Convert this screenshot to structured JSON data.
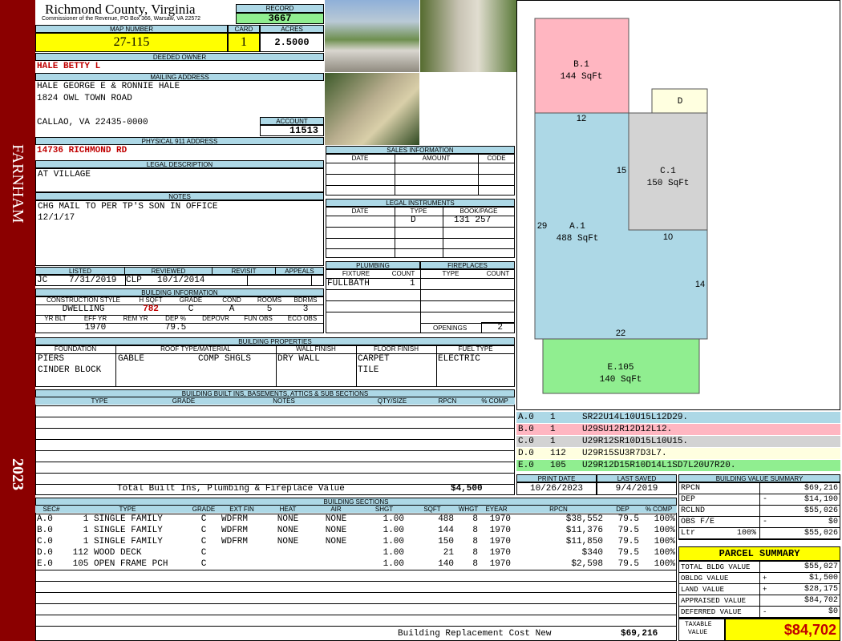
{
  "side_band": {
    "town": "FARNHAM",
    "year": "2023"
  },
  "header": {
    "county": "Richmond County, Virginia",
    "commissioner": "Commissioner of the Revenue, PO Box 366, Warsaw, VA 22572",
    "record_label": "RECORD",
    "record_value": "3667",
    "map_label": "MAP NUMBER",
    "map_value": "27-115",
    "card_label": "CARD",
    "card_value": "1",
    "acres_label": "ACRES",
    "acres_value": "2.5000"
  },
  "owner": {
    "label": "DEEDED OWNER",
    "value": "HALE BETTY L"
  },
  "mailing": {
    "label": "MAILING ADDRESS",
    "line1": "HALE GEORGE E & RONNIE HALE",
    "line2": "1824 OWL TOWN ROAD",
    "line3": "CALLAO, VA 22435-0000"
  },
  "account": {
    "label": "ACCOUNT",
    "value": "11513"
  },
  "physical": {
    "label": "PHYSICAL 911 ADDRESS",
    "value": "14736 RICHMOND RD"
  },
  "legal": {
    "label": "LEGAL DESCRIPTION",
    "value": "AT VILLAGE"
  },
  "notes": {
    "label": "NOTES",
    "line1": "CHG MAIL TO PER TP'S SON IN OFFICE",
    "line2": "12/1/17"
  },
  "sales": {
    "title": "SALES INFORMATION",
    "cols": [
      "DATE",
      "AMOUNT",
      "CODE"
    ]
  },
  "legal_instruments": {
    "title": "LEGAL INSTRUMENTS",
    "cols": [
      "DATE",
      "TYPE",
      "BOOK/PAGE"
    ],
    "row": {
      "date": "",
      "type": "D",
      "bookpage": "131 257"
    }
  },
  "listing": {
    "cols": [
      "LISTED",
      "REVIEWED",
      "REVISIT",
      "APPEALS"
    ],
    "listed_by": "JC",
    "listed_date": "7/31/2019",
    "reviewed_by": "CLP",
    "reviewed_date": "10/1/2014"
  },
  "building_info": {
    "title": "BUILDING INFORMATION",
    "cols": [
      "CONSTRUCTION STYLE",
      "H SQFT",
      "GRADE",
      "COND",
      "ROOMS",
      "BDRMS"
    ],
    "values": [
      "DWELLING",
      "782",
      "C",
      "A",
      "5",
      "3"
    ],
    "cols2": [
      "YR BLT",
      "EFF YR",
      "REM YR",
      "DEP %",
      "DEPOVR",
      "FUN OBS",
      "ECO OBS"
    ],
    "values2": [
      "",
      "1970",
      "",
      "79.5",
      "",
      "",
      ""
    ]
  },
  "plumbing": {
    "title": "PLUMBING",
    "cols": [
      "FIXTURE",
      "COUNT"
    ],
    "fixture": "FULLBATH",
    "count": "1"
  },
  "fireplaces": {
    "title": "FIREPLACES",
    "cols": [
      "TYPE",
      "COUNT"
    ],
    "openings_label": "OPENINGS",
    "openings_value": "2"
  },
  "properties": {
    "title": "BUILDING PROPERTIES",
    "cols": [
      "FOUNDATION",
      "ROOF TYPE/MATERIAL",
      "WALL FINISH",
      "FLOOR FINISH",
      "FUEL TYPE"
    ],
    "foundation1": "PIERS",
    "foundation2": "CINDER BLOCK",
    "roof_type": "GABLE",
    "roof_material": "COMP SHGLS",
    "wall": "DRY WALL",
    "floor1": "CARPET",
    "floor2": "TILE",
    "fuel": "ELECTRIC"
  },
  "builtins": {
    "title": "BUILDING BUILT INS, BASEMENTS, ATTICS & SUB SECTIONS",
    "cols": [
      "TYPE",
      "GRADE",
      "NOTES",
      "QTY/SIZE",
      "RPCN",
      "% COMP"
    ],
    "total_label": "Total Built Ins, Plumbing & Fireplace Value",
    "total_value": "$4,500"
  },
  "sections": {
    "title": "BUILDING SECTIONS",
    "cols": [
      "SEC#",
      "TYPE",
      "GRADE",
      "EXT FIN",
      "HEAT",
      "AIR",
      "SHGT",
      "SQFT",
      "WHGT",
      "EYEAR",
      "RPCN",
      "DEP",
      "% COMP"
    ],
    "rows": [
      {
        "sec": "A.0",
        "type": "   1 SINGLE FAMILY",
        "grade": "C",
        "ext": "WDFRM",
        "heat": "NONE",
        "air": "NONE",
        "shgt": "1.00",
        "sqft": "488",
        "whgt": "8",
        "eyear": "1970",
        "rpcn": "$38,552",
        "dep": "79.5",
        "comp": "100%"
      },
      {
        "sec": "B.0",
        "type": "   1 SINGLE FAMILY",
        "grade": "C",
        "ext": "WDFRM",
        "heat": "NONE",
        "air": "NONE",
        "shgt": "1.00",
        "sqft": "144",
        "whgt": "8",
        "eyear": "1970",
        "rpcn": "$11,376",
        "dep": "79.5",
        "comp": "100%"
      },
      {
        "sec": "C.0",
        "type": "   1 SINGLE FAMILY",
        "grade": "C",
        "ext": "WDFRM",
        "heat": "NONE",
        "air": "NONE",
        "shgt": "1.00",
        "sqft": "150",
        "whgt": "8",
        "eyear": "1970",
        "rpcn": "$11,850",
        "dep": "79.5",
        "comp": "100%"
      },
      {
        "sec": "D.0",
        "type": " 112 WOOD DECK",
        "grade": "C",
        "ext": "",
        "heat": "",
        "air": "",
        "shgt": "1.00",
        "sqft": "21",
        "whgt": "8",
        "eyear": "1970",
        "rpcn": "$340",
        "dep": "79.5",
        "comp": "100%"
      },
      {
        "sec": "E.0",
        "type": " 105 OPEN FRAME PCH",
        "grade": "C",
        "ext": "",
        "heat": "",
        "air": "",
        "shgt": "1.00",
        "sqft": "140",
        "whgt": "8",
        "eyear": "1970",
        "rpcn": "$2,598",
        "dep": "79.5",
        "comp": "100%"
      }
    ],
    "replacement_label": "Building Replacement Cost New",
    "replacement_value": "$69,216"
  },
  "sketch": {
    "areas": [
      {
        "label": "B.1",
        "sqft": "144 SqFt",
        "color": "#ffb6c1"
      },
      {
        "label": "D",
        "color": "#ffffe0"
      },
      {
        "label": "C.1",
        "sqft": "150 SqFt",
        "color": "#d3d3d3"
      },
      {
        "label": "A.1",
        "sqft": "488 SqFt",
        "color": "#add8e6"
      },
      {
        "label": "E.105",
        "sqft": "140 SqFt",
        "color": "#90ee90"
      }
    ],
    "dims": [
      "12",
      "15",
      "29",
      "10",
      "14",
      "22"
    ]
  },
  "sketch_legend": [
    {
      "code": "A.0",
      "num": "1",
      "path": "SR22U14L10U15L12D29.",
      "color": "#add8e6"
    },
    {
      "code": "B.0",
      "num": "1",
      "path": "U29SU12R12D12L12.",
      "color": "#ffb6c1"
    },
    {
      "code": "C.0",
      "num": "1",
      "path": "U29R12SR10D15L10U15.",
      "color": "#d3d3d3"
    },
    {
      "code": "D.0",
      "num": "112",
      "path": "U29R15SU3R7D3L7.",
      "color": "#ffffe0"
    },
    {
      "code": "E.0",
      "num": "105",
      "path": "U29R12D15R10D14L1SD7L20U7R20.",
      "color": "#90ee90"
    }
  ],
  "dates": {
    "print_label": "PRINT DATE",
    "print_value": "10/26/2023",
    "saved_label": "LAST SAVED",
    "saved_value": "9/4/2019"
  },
  "value_summary": {
    "title": "BUILDING VALUE SUMMARY",
    "rows": [
      {
        "label": "RPCN",
        "sign": "",
        "value": "$69,216"
      },
      {
        "label": "DEP",
        "sign": "-",
        "value": "$14,190"
      },
      {
        "label": "RCLND",
        "sign": "",
        "value": "$55,026"
      },
      {
        "label": "OBS F/E",
        "sign": "-",
        "value": "$0"
      },
      {
        "label": "Ltr",
        "pct": "100%",
        "sign": "",
        "value": "$55,026"
      }
    ]
  },
  "parcel_summary": {
    "title": "PARCEL SUMMARY",
    "rows": [
      {
        "label": "TOTAL BLDG VALUE",
        "sign": "",
        "value": "$55,027"
      },
      {
        "label": "OBLDG VALUE",
        "sign": "+",
        "value": "$1,500"
      },
      {
        "label": "LAND VALUE",
        "sign": "+",
        "value": "$28,175"
      },
      {
        "label": "APPRAISED VALUE",
        "sign": "",
        "value": "$84,702"
      },
      {
        "label": "DEFERRED VALUE",
        "sign": "-",
        "value": "$0"
      }
    ],
    "taxable_label1": "TAXABLE",
    "taxable_label2": "VALUE",
    "taxable_value": "$84,702"
  },
  "colors": {
    "band": "#8b0000",
    "header_blue": "#add8e6",
    "yellow": "#ffff00",
    "green": "#90ee90",
    "red_text": "#c00000"
  }
}
